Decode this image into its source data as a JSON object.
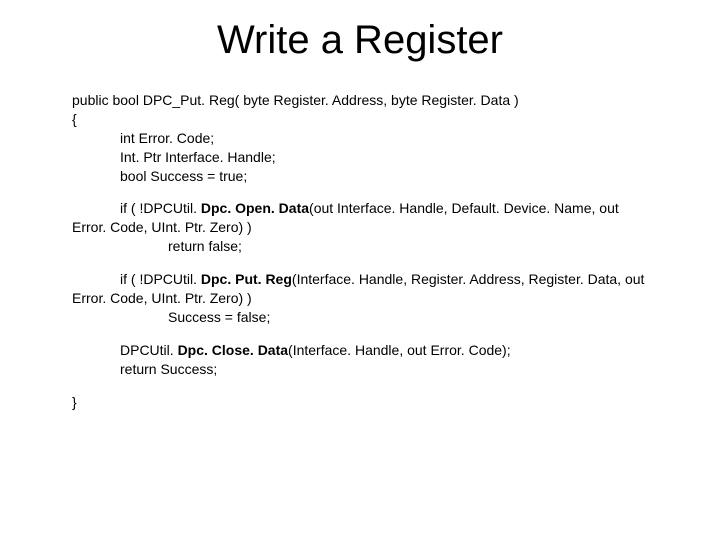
{
  "title": "Write a Register",
  "sig_line": "public bool DPC_Put. Reg( byte Register. Address, byte Register. Data )",
  "open_brace": "{",
  "decl1": "int Error. Code;",
  "decl2": "Int. Ptr Interface. Handle;",
  "decl3": "bool Success = true;",
  "if1_a": "if ( !DPCUtil. ",
  "if1_bold": "Dpc. Open. Data",
  "if1_b": "(out Interface. Handle, Default. Device. Name, out",
  "if1_c": "Error. Code, UInt. Ptr. Zero) )",
  "if1_ret": "return false;",
  "if2_a": "if ( !DPCUtil. ",
  "if2_bold": "Dpc. Put. Reg",
  "if2_b": "(Interface. Handle, Register. Address, Register. Data, out",
  "if2_c": "Error. Code, UInt. Ptr. Zero) )",
  "if2_ret": "Success = false;",
  "close1_a": "DPCUtil. ",
  "close1_bold": "Dpc. Close. Data",
  "close1_b": "(Interface. Handle, out Error. Code);",
  "ret": "return Success;",
  "close_brace": "}"
}
